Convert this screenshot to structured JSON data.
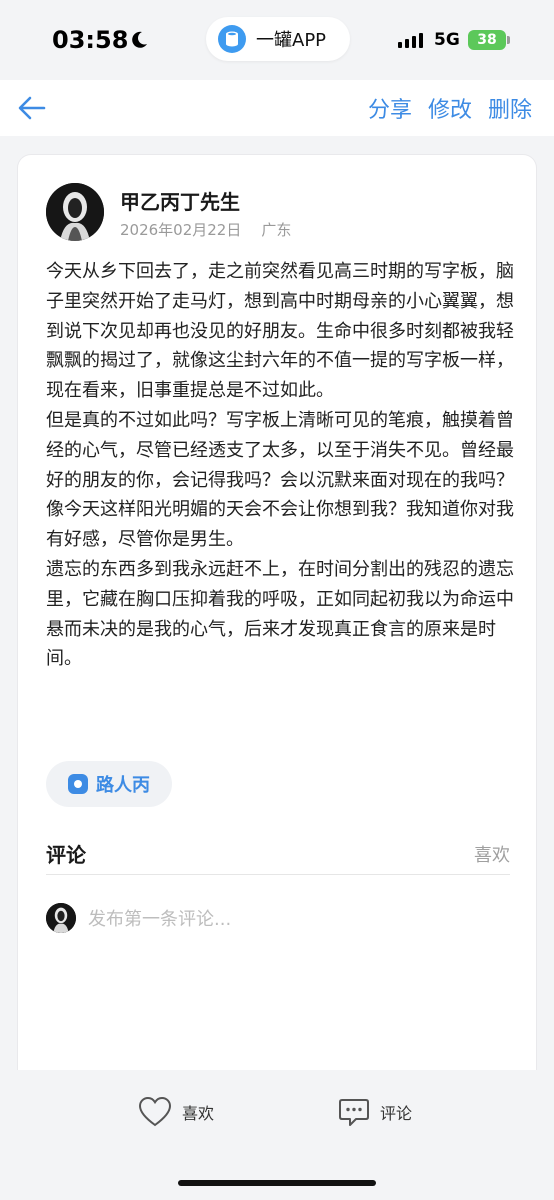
{
  "status_bar": {
    "time": "03:58",
    "app_name": "一罐APP",
    "network": "5G",
    "battery": "38"
  },
  "nav": {
    "share": "分享",
    "edit": "修改",
    "delete": "删除",
    "accent_color": "#3d8be4"
  },
  "post": {
    "author": "甲乙丙丁先生",
    "date": "2026年02月22日",
    "location": "广东",
    "body": "今天从乡下回去了，走之前突然看见高三时期的写字板，脑子里突然开始了走马灯，想到高中时期母亲的小心翼翼，想到说下次见却再也没见的好朋友。生命中很多时刻都被我轻飘飘的揭过了，就像这尘封六年的不值一提的写字板一样，现在看来，旧事重提总是不过如此。\n但是真的不过如此吗？写字板上清晰可见的笔痕，触摸着曾经的心气，尽管已经透支了太多，以至于消失不见。曾经最好的朋友的你，会记得我吗？会以沉默来面对现在的我吗？像今天这样阳光明媚的天会不会让你想到我？我知道你对我有好感，尽管你是男生。\n遗忘的东西多到我永远赶不上，在时间分割出的残忍的遗忘里，它藏在胸口压抑着我的呼吸，正如同起初我以为命运中悬而未决的是我的心气，后来才发现真正食言的原来是时间。",
    "tag": "路人丙"
  },
  "comments": {
    "title": "评论",
    "likes_tab": "喜欢",
    "placeholder": "发布第一条评论..."
  },
  "bottom_bar": {
    "like_label": "喜欢",
    "comment_label": "评论"
  }
}
